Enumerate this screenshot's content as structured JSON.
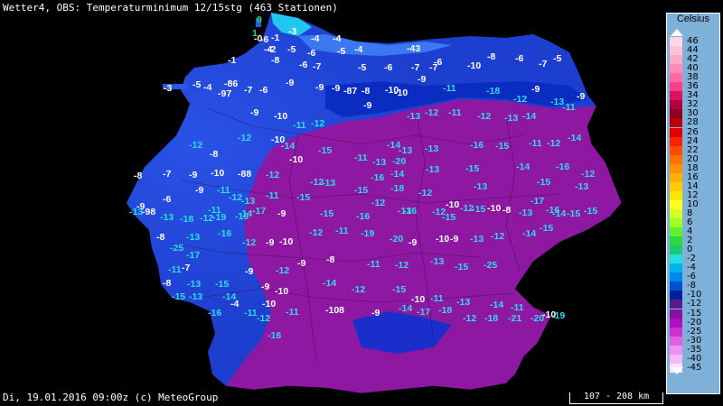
{
  "header": {
    "title": "Wetter4, OBS: Temperaturminimum 12/15stg (463 Stationen)"
  },
  "footer": {
    "timestamp": "Di, 19.01.2016 09:00z (c) MeteoGroup",
    "scale": "107 - 208 km"
  },
  "legend": {
    "unit": "Celsius",
    "entries": [
      {
        "label": "46",
        "color": "#ffd6e6"
      },
      {
        "label": "44",
        "color": "#ffc0d8"
      },
      {
        "label": "42",
        "color": "#ffa8c8"
      },
      {
        "label": "40",
        "color": "#ff8ab4"
      },
      {
        "label": "38",
        "color": "#ff6aa0"
      },
      {
        "label": "36",
        "color": "#ff3c88"
      },
      {
        "label": "34",
        "color": "#e01060"
      },
      {
        "label": "32",
        "color": "#b00040"
      },
      {
        "label": "30",
        "color": "#8c0020"
      },
      {
        "label": "28",
        "color": "#c00000"
      },
      {
        "label": "26",
        "color": "#e00000"
      },
      {
        "label": "24",
        "color": "#ff2000"
      },
      {
        "label": "22",
        "color": "#ff4a00"
      },
      {
        "label": "20",
        "color": "#ff7000"
      },
      {
        "label": "18",
        "color": "#ff9000"
      },
      {
        "label": "16",
        "color": "#ffb000"
      },
      {
        "label": "14",
        "color": "#ffcc00"
      },
      {
        "label": "12",
        "color": "#ffe600"
      },
      {
        "label": "10",
        "color": "#ffff20"
      },
      {
        "label": "8",
        "color": "#d8ff20"
      },
      {
        "label": "6",
        "color": "#a0ff20"
      },
      {
        "label": "4",
        "color": "#60f030"
      },
      {
        "label": "2",
        "color": "#30d840"
      },
      {
        "label": "0",
        "color": "#20c870"
      },
      {
        "label": "-2",
        "color": "#20e0e0"
      },
      {
        "label": "-4",
        "color": "#00b4f0"
      },
      {
        "label": "-6",
        "color": "#0088e8"
      },
      {
        "label": "-8",
        "color": "#0050d0"
      },
      {
        "label": "-10",
        "color": "#0020a0"
      },
      {
        "label": "-12",
        "color": "#5a1a8a"
      },
      {
        "label": "-15",
        "color": "#8c10a0"
      },
      {
        "label": "-20",
        "color": "#b010c0"
      },
      {
        "label": "-25",
        "color": "#d030d0"
      },
      {
        "label": "-30",
        "color": "#e060e0"
      },
      {
        "label": "-35",
        "color": "#f090f0"
      },
      {
        "label": "-40",
        "color": "#f8b8f8"
      },
      {
        "label": "-45",
        "color": "#ffe0ff"
      }
    ]
  },
  "stations": [
    {
      "v": "0",
      "t": "g"
    },
    {
      "v": "1",
      "t": "g"
    },
    {
      "v": "-3",
      "t": "w"
    },
    {
      "v": "-4",
      "t": "w"
    },
    {
      "v": "-4",
      "t": "w"
    },
    {
      "v": "-6",
      "t": "w"
    },
    {
      "v": "-4",
      "t": "w"
    },
    {
      "v": "-5",
      "t": "w"
    },
    {
      "v": "-0",
      "t": "w"
    },
    {
      "v": "-1",
      "t": "w"
    },
    {
      "v": "-2",
      "t": "w"
    },
    {
      "v": "-6",
      "t": "w"
    },
    {
      "v": "-5",
      "t": "w"
    },
    {
      "v": "-4",
      "t": "w"
    },
    {
      "v": "-43",
      "t": "w"
    },
    {
      "v": "-1",
      "t": "w"
    },
    {
      "v": "-4",
      "t": "w"
    },
    {
      "v": "-8",
      "t": "w"
    },
    {
      "v": "-6",
      "t": "w"
    },
    {
      "v": "-7",
      "t": "w"
    },
    {
      "v": "-5",
      "t": "w"
    },
    {
      "v": "-6",
      "t": "w"
    },
    {
      "v": "-7",
      "t": "w"
    },
    {
      "v": "-7",
      "t": "w"
    },
    {
      "v": "-6",
      "t": "w"
    },
    {
      "v": "-10",
      "t": "w"
    },
    {
      "v": "-8",
      "t": "w"
    },
    {
      "v": "-6",
      "t": "w"
    },
    {
      "v": "-7",
      "t": "w"
    },
    {
      "v": "-5",
      "t": "w"
    },
    {
      "v": "-3",
      "t": "w"
    },
    {
      "v": "-86",
      "t": "w"
    },
    {
      "v": "-5",
      "t": "w"
    },
    {
      "v": "-97",
      "t": "w"
    },
    {
      "v": "-7",
      "t": "w"
    },
    {
      "v": "-6",
      "t": "w"
    },
    {
      "v": "-9",
      "t": "w"
    },
    {
      "v": "-9",
      "t": "w"
    },
    {
      "v": "-9",
      "t": "w"
    },
    {
      "v": "-87",
      "t": "w"
    },
    {
      "v": "-8",
      "t": "w"
    },
    {
      "v": "-10",
      "t": "w"
    },
    {
      "v": "-9",
      "t": "w"
    },
    {
      "v": "-11",
      "t": "c"
    },
    {
      "v": "-18",
      "t": "c"
    },
    {
      "v": "-9",
      "t": "w"
    },
    {
      "v": "-9",
      "t": "w"
    },
    {
      "v": "-9",
      "t": "w"
    },
    {
      "v": "-10",
      "t": "w"
    },
    {
      "v": "-12",
      "t": "c"
    },
    {
      "v": "-11",
      "t": "c"
    },
    {
      "v": "-12",
      "t": "c"
    },
    {
      "v": "-9",
      "t": "w"
    },
    {
      "v": "-10",
      "t": "w"
    },
    {
      "v": "-13",
      "t": "c"
    },
    {
      "v": "-12",
      "t": "c"
    },
    {
      "v": "-11",
      "t": "c"
    },
    {
      "v": "-12",
      "t": "c"
    },
    {
      "v": "-13",
      "t": "c"
    },
    {
      "v": "-14",
      "t": "c"
    },
    {
      "v": "-13",
      "t": "c"
    },
    {
      "v": "-12",
      "t": "c"
    },
    {
      "v": "-11",
      "t": "c"
    },
    {
      "v": "-10",
      "t": "w"
    },
    {
      "v": "-14",
      "t": "c"
    },
    {
      "v": "-12",
      "t": "c"
    },
    {
      "v": "-10",
      "t": "w"
    },
    {
      "v": "-15",
      "t": "c"
    },
    {
      "v": "-11",
      "t": "c"
    },
    {
      "v": "-13",
      "t": "c"
    },
    {
      "v": "-14",
      "t": "c"
    },
    {
      "v": "-13",
      "t": "c"
    },
    {
      "v": "-16",
      "t": "c"
    },
    {
      "v": "-15",
      "t": "c"
    },
    {
      "v": "-11",
      "t": "c"
    },
    {
      "v": "-12",
      "t": "c"
    },
    {
      "v": "-14",
      "t": "c"
    },
    {
      "v": "-12",
      "t": "c"
    },
    {
      "v": "-8",
      "t": "w"
    },
    {
      "v": "-9",
      "t": "w"
    },
    {
      "v": "-11",
      "t": "c"
    },
    {
      "v": "-14",
      "t": "c"
    },
    {
      "v": "-13",
      "t": "c"
    },
    {
      "v": "-20",
      "t": "c"
    },
    {
      "v": "-16",
      "t": "c"
    },
    {
      "v": "-14",
      "t": "c"
    },
    {
      "v": "-13",
      "t": "c"
    },
    {
      "v": "-15",
      "t": "c"
    },
    {
      "v": "-14",
      "t": "c"
    },
    {
      "v": "-16",
      "t": "c"
    },
    {
      "v": "-12",
      "t": "c"
    },
    {
      "v": "-8",
      "t": "w"
    },
    {
      "v": "-7",
      "t": "w"
    },
    {
      "v": "-9",
      "t": "w"
    },
    {
      "v": "-10",
      "t": "w"
    },
    {
      "v": "-88",
      "t": "w"
    },
    {
      "v": "-11",
      "t": "c"
    },
    {
      "v": "-12",
      "t": "c"
    },
    {
      "v": "-13",
      "t": "c"
    },
    {
      "v": "-15",
      "t": "c"
    },
    {
      "v": "-18",
      "t": "c"
    },
    {
      "v": "-12",
      "t": "c"
    },
    {
      "v": "-13",
      "t": "c"
    },
    {
      "v": "-15",
      "t": "c"
    },
    {
      "v": "-13",
      "t": "c"
    },
    {
      "v": "-9",
      "t": "w"
    },
    {
      "v": "-6",
      "t": "w"
    },
    {
      "v": "-11",
      "t": "c"
    },
    {
      "v": "-12",
      "t": "c"
    },
    {
      "v": "-13",
      "t": "c"
    },
    {
      "v": "-15",
      "t": "c"
    },
    {
      "v": "-12",
      "t": "c"
    },
    {
      "v": "-16",
      "t": "c"
    },
    {
      "v": "-12",
      "t": "c"
    },
    {
      "v": "-10",
      "t": "w"
    },
    {
      "v": "-12",
      "t": "c"
    },
    {
      "v": "-17",
      "t": "c"
    },
    {
      "v": "-16",
      "t": "c"
    },
    {
      "v": "-13",
      "t": "c"
    },
    {
      "v": "-98",
      "t": "w"
    },
    {
      "v": "-8",
      "t": "w"
    },
    {
      "v": "-13",
      "t": "c"
    },
    {
      "v": "-12",
      "t": "c"
    },
    {
      "v": "-19",
      "t": "c"
    },
    {
      "v": "-16",
      "t": "c"
    },
    {
      "v": "-17",
      "t": "c"
    },
    {
      "v": "-9",
      "t": "w"
    },
    {
      "v": "-15",
      "t": "c"
    },
    {
      "v": "-16",
      "t": "c"
    },
    {
      "v": "-13",
      "t": "c"
    },
    {
      "v": "-15",
      "t": "c"
    },
    {
      "v": "-15",
      "t": "c"
    },
    {
      "v": "-10",
      "t": "w"
    },
    {
      "v": "-8",
      "t": "w"
    },
    {
      "v": "-13",
      "t": "c"
    },
    {
      "v": "-14",
      "t": "c"
    },
    {
      "v": "-15",
      "t": "c"
    },
    {
      "v": "-15",
      "t": "c"
    },
    {
      "v": "-13",
      "t": "c"
    },
    {
      "v": "-18",
      "t": "c"
    },
    {
      "v": "-25",
      "t": "c"
    },
    {
      "v": "-17",
      "t": "c"
    },
    {
      "v": "-16",
      "t": "c"
    },
    {
      "v": "-12",
      "t": "c"
    },
    {
      "v": "-9",
      "t": "w"
    },
    {
      "v": "-10",
      "t": "w"
    },
    {
      "v": "-12",
      "t": "c"
    },
    {
      "v": "-11",
      "t": "c"
    },
    {
      "v": "-19",
      "t": "c"
    },
    {
      "v": "-20",
      "t": "c"
    },
    {
      "v": "-9",
      "t": "w"
    },
    {
      "v": "-10",
      "t": "w"
    },
    {
      "v": "-9",
      "t": "w"
    },
    {
      "v": "-13",
      "t": "c"
    },
    {
      "v": "-12",
      "t": "c"
    },
    {
      "v": "-14",
      "t": "c"
    },
    {
      "v": "-15",
      "t": "c"
    },
    {
      "v": "-11",
      "t": "c"
    },
    {
      "v": "-7",
      "t": "w"
    },
    {
      "v": "-9",
      "t": "w"
    },
    {
      "v": "-12",
      "t": "c"
    },
    {
      "v": "-9",
      "t": "w"
    },
    {
      "v": "-8",
      "t": "w"
    },
    {
      "v": "-11",
      "t": "c"
    },
    {
      "v": "-12",
      "t": "c"
    },
    {
      "v": "-13",
      "t": "c"
    },
    {
      "v": "-15",
      "t": "c"
    },
    {
      "v": "-25",
      "t": "c"
    },
    {
      "v": "-8",
      "t": "w"
    },
    {
      "v": "-13",
      "t": "c"
    },
    {
      "v": "-15",
      "t": "c"
    },
    {
      "v": "-14",
      "t": "c"
    },
    {
      "v": "-9",
      "t": "w"
    },
    {
      "v": "-10",
      "t": "w"
    },
    {
      "v": "-14",
      "t": "c"
    },
    {
      "v": "-12",
      "t": "c"
    },
    {
      "v": "-15",
      "t": "c"
    },
    {
      "v": "-10",
      "t": "w"
    },
    {
      "v": "-11",
      "t": "c"
    },
    {
      "v": "-13",
      "t": "c"
    },
    {
      "v": "-14",
      "t": "c"
    },
    {
      "v": "-11",
      "t": "c"
    },
    {
      "v": "-10",
      "t": "w"
    },
    {
      "v": "-15",
      "t": "c"
    },
    {
      "v": "-13",
      "t": "c"
    },
    {
      "v": "-16",
      "t": "c"
    },
    {
      "v": "-4",
      "t": "w"
    },
    {
      "v": "-10",
      "t": "w"
    },
    {
      "v": "-11",
      "t": "c"
    },
    {
      "v": "-108",
      "t": "w"
    },
    {
      "v": "-9",
      "t": "w"
    },
    {
      "v": "-14",
      "t": "c"
    },
    {
      "v": "-17",
      "t": "c"
    },
    {
      "v": "-18",
      "t": "c"
    },
    {
      "v": "-12",
      "t": "c"
    },
    {
      "v": "-18",
      "t": "c"
    },
    {
      "v": "-21",
      "t": "c"
    },
    {
      "v": "-20",
      "t": "c"
    },
    {
      "v": "-19",
      "t": "c"
    },
    {
      "v": "-11",
      "t": "c"
    },
    {
      "v": "-12",
      "t": "c"
    },
    {
      "v": "-16",
      "t": "c"
    }
  ]
}
